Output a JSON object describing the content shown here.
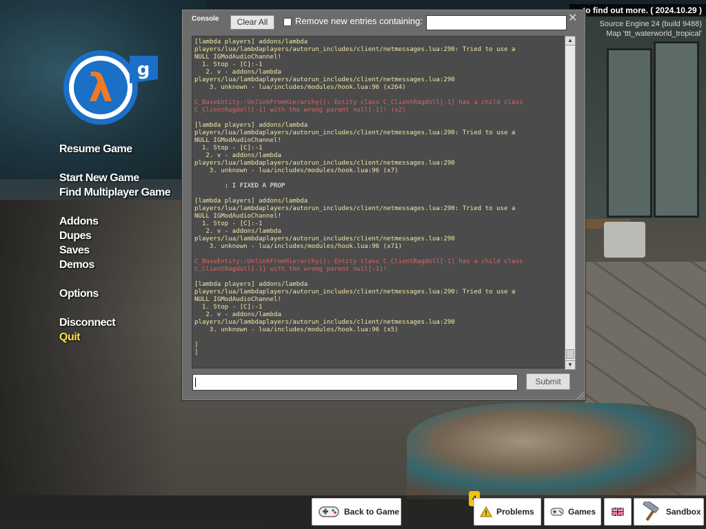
{
  "top_info": {
    "notice": "... to find out more. ( 2024.10.29 )",
    "engine": "Source Engine 24 (build 9488)",
    "map": "Map 'ttt_waterworld_tropical'"
  },
  "menu": {
    "items": [
      {
        "label": "Resume Game"
      },
      {
        "label": "Start New Game"
      },
      {
        "label": "Find Multiplayer Game"
      },
      {
        "label": "Addons"
      },
      {
        "label": "Dupes"
      },
      {
        "label": "Saves"
      },
      {
        "label": "Demos"
      },
      {
        "label": "Options"
      },
      {
        "label": "Disconnect"
      },
      {
        "label": "Quit"
      }
    ],
    "quit_color": "#ffe14b"
  },
  "console": {
    "title": "Console",
    "clear_label": "Clear All",
    "filter_label": "Remove new entries containing:",
    "filter_value": "",
    "submit_label": "Submit",
    "command_value": "",
    "lines": [
      {
        "c": "y",
        "t": "[lambda players] addons/lambda"
      },
      {
        "c": "y",
        "t": "players/lua/lambdaplayers/autorun_includes/client/netmessages.lua:290: Tried to use a"
      },
      {
        "c": "y",
        "t": "NULL IGModAudioChannel!"
      },
      {
        "c": "y",
        "t": "  1. Stop - [C]:-1"
      },
      {
        "c": "y",
        "t": "   2. v - addons/lambda"
      },
      {
        "c": "y",
        "t": "players/lua/lambdaplayers/autorun_includes/client/netmessages.lua:290"
      },
      {
        "c": "y",
        "t": "    3. unknown - lua/includes/modules/hook.lua:96 (x264)"
      },
      {
        "c": "y",
        "t": ""
      },
      {
        "c": "r",
        "t": "C_BaseEntity::UnlinkFromHierarchy(): Entity class C_ClientRagdoll[-1] has a child class"
      },
      {
        "c": "r",
        "t": "C_ClientRagdoll[-1] with the wrong parent null[-1]! (x2)"
      },
      {
        "c": "y",
        "t": ""
      },
      {
        "c": "y",
        "t": "[lambda players] addons/lambda"
      },
      {
        "c": "y",
        "t": "players/lua/lambdaplayers/autorun_includes/client/netmessages.lua:290: Tried to use a"
      },
      {
        "c": "y",
        "t": "NULL IGModAudioChannel!"
      },
      {
        "c": "y",
        "t": "  1. Stop - [C]:-1"
      },
      {
        "c": "y",
        "t": "   2. v - addons/lambda"
      },
      {
        "c": "y",
        "t": "players/lua/lambdaplayers/autorun_includes/client/netmessages.lua:290"
      },
      {
        "c": "y",
        "t": "    3. unknown - lua/includes/modules/hook.lua:96 (x7)"
      },
      {
        "c": "y",
        "t": ""
      },
      {
        "c": "w",
        "t": "        : I FIXED A PROP"
      },
      {
        "c": "y",
        "t": ""
      },
      {
        "c": "y",
        "t": "[lambda players] addons/lambda"
      },
      {
        "c": "y",
        "t": "players/lua/lambdaplayers/autorun_includes/client/netmessages.lua:290: Tried to use a"
      },
      {
        "c": "y",
        "t": "NULL IGModAudioChannel!"
      },
      {
        "c": "y",
        "t": "  1. Stop - [C]:-1"
      },
      {
        "c": "y",
        "t": "   2. v - addons/lambda"
      },
      {
        "c": "y",
        "t": "players/lua/lambdaplayers/autorun_includes/client/netmessages.lua:290"
      },
      {
        "c": "y",
        "t": "    3. unknown - lua/includes/modules/hook.lua:96 (x71)"
      },
      {
        "c": "y",
        "t": ""
      },
      {
        "c": "r",
        "t": "C_BaseEntity::UnlinkFromHierarchy(): Entity class C_ClientRagdoll[-1] has a child class"
      },
      {
        "c": "r",
        "t": "C_ClientRagdoll[-1] with the wrong parent null[-1]!"
      },
      {
        "c": "y",
        "t": ""
      },
      {
        "c": "y",
        "t": "[lambda players] addons/lambda"
      },
      {
        "c": "y",
        "t": "players/lua/lambdaplayers/autorun_includes/client/netmessages.lua:290: Tried to use a"
      },
      {
        "c": "y",
        "t": "NULL IGModAudioChannel!"
      },
      {
        "c": "y",
        "t": "  1. Stop - [C]:-1"
      },
      {
        "c": "y",
        "t": "   2. v - addons/lambda"
      },
      {
        "c": "y",
        "t": "players/lua/lambdaplayers/autorun_includes/client/netmessages.lua:290"
      },
      {
        "c": "y",
        "t": "    3. unknown - lua/includes/modules/hook.lua:96 (x5)"
      },
      {
        "c": "y",
        "t": ""
      },
      {
        "c": "y",
        "t": "]"
      },
      {
        "c": "y",
        "t": "]"
      }
    ],
    "colors": {
      "y": "#f2e8a6",
      "r": "#e06262",
      "w": "#ffffff"
    }
  },
  "bottom_bar": {
    "back_label": "Back to Game",
    "problems_label": "Problems",
    "problems_count": "4",
    "games_label": "Games",
    "sandbox_label": "Sandbox",
    "icons": {
      "back": "gamepad-icon",
      "problems": "warning-icon",
      "games": "gamepad-small-icon",
      "language": "uk-flag-icon",
      "sandbox": "hammer-icon"
    }
  }
}
